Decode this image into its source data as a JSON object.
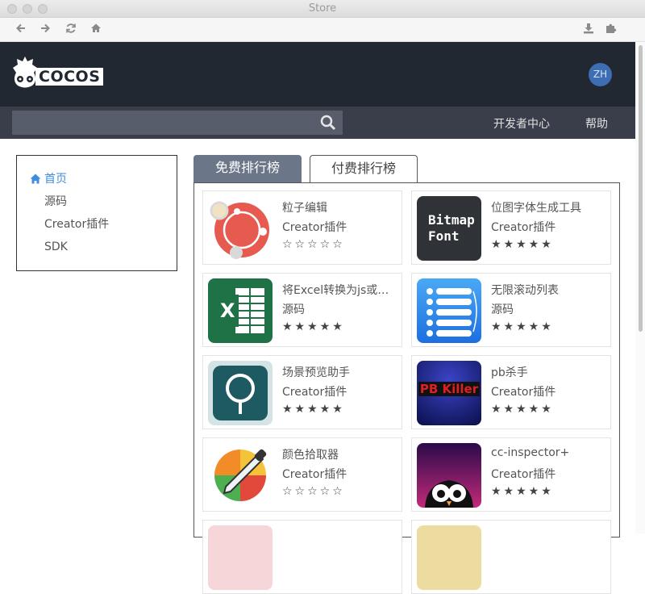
{
  "window": {
    "title": "Store"
  },
  "header": {
    "logo_text": "COCOS",
    "lang_label": "ZH"
  },
  "navbar": {
    "search_placeholder": "",
    "links": [
      "开发者中心",
      "帮助"
    ]
  },
  "sidebar": {
    "items": [
      {
        "label": "首页",
        "active": true
      },
      {
        "label": "源码",
        "active": false
      },
      {
        "label": "Creator插件",
        "active": false
      },
      {
        "label": "SDK",
        "active": false
      }
    ]
  },
  "tabs": {
    "free": "免费排行榜",
    "paid": "付费排行榜",
    "selected": "paid"
  },
  "cards": [
    {
      "name": "粒子编辑",
      "category": "Creator插件",
      "rating": 0,
      "icon": "particle-editor-icon"
    },
    {
      "name": "位图字体生成工具",
      "category": "Creator插件",
      "rating": 5,
      "icon": "bitmap-font-icon",
      "icon_text_1": "Bitmap",
      "icon_text_2": "Font"
    },
    {
      "name": "将Excel转换为js或者…",
      "category": "源码",
      "rating": 5,
      "icon": "excel-icon",
      "icon_text_1": "X"
    },
    {
      "name": "无限滚动列表",
      "category": "源码",
      "rating": 5,
      "icon": "scroll-list-icon"
    },
    {
      "name": "场景预览助手",
      "category": "Creator插件",
      "rating": 5,
      "icon": "scene-preview-icon"
    },
    {
      "name": "pb杀手",
      "category": "Creator插件",
      "rating": 5,
      "icon": "pb-killer-icon",
      "icon_text_1": "PB Killer"
    },
    {
      "name": "颜色拾取器",
      "category": "Creator插件",
      "rating": 0,
      "icon": "color-picker-icon"
    },
    {
      "name": "cc-inspector+",
      "category": "Creator插件",
      "rating": 5,
      "icon": "cc-inspector-icon"
    },
    {
      "name": "",
      "category": "",
      "rating": 0,
      "icon": "partial-icon-1"
    },
    {
      "name": "",
      "category": "",
      "rating": 0,
      "icon": "partial-icon-2"
    }
  ],
  "colors": {
    "header_bg": "#222831",
    "navbar_bg": "#393e4a",
    "accent": "#3f8edb",
    "tab_free_bg": "#6b7689"
  }
}
